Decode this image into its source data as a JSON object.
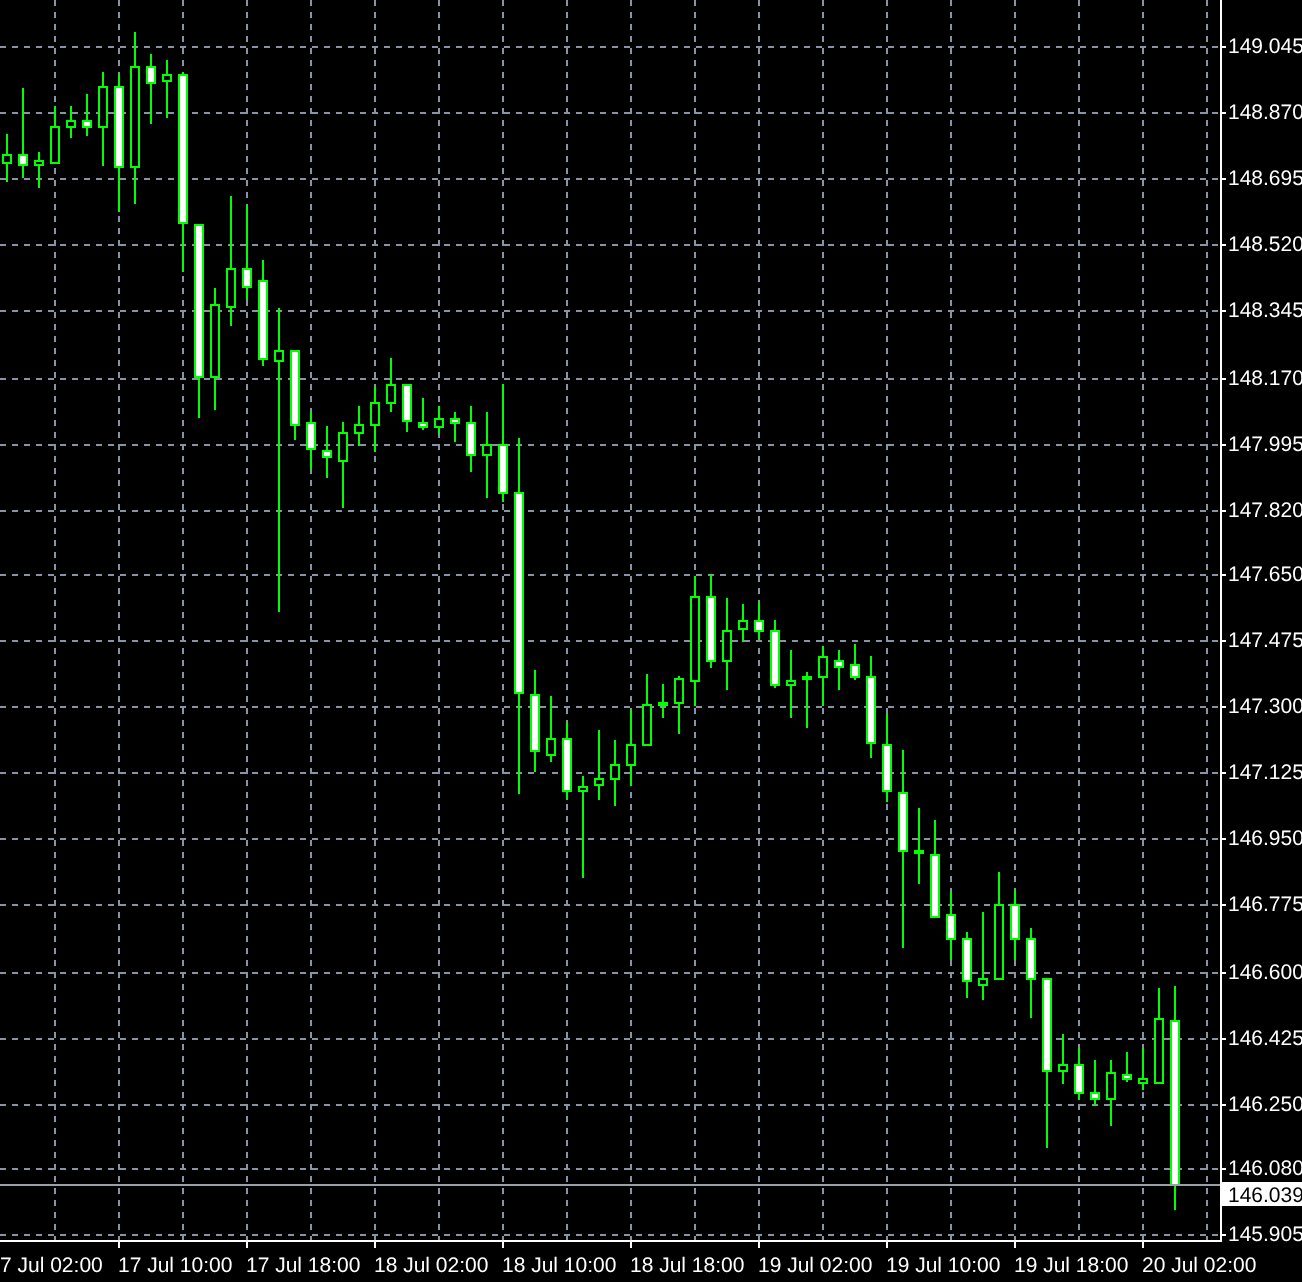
{
  "chart": {
    "time_axis": {
      "labels": [
        "7 Jul 02:00",
        "17 Jul 10:00",
        "17 Jul 18:00",
        "18 Jul 02:00",
        "18 Jul 10:00",
        "18 Jul 18:00",
        "19 Jul 02:00",
        "19 Jul 10:00",
        "19 Jul 18:00",
        "20 Jul 02:00"
      ]
    },
    "chart_data": {
      "type": "candlestick",
      "ylim": [
        145.905,
        149.045
      ],
      "grid": true,
      "ref_lines": [
        {
          "axis": "y",
          "value": 146.039,
          "label": "146.039"
        }
      ],
      "yticks": [
        {
          "value": 149.045,
          "label": "149.045"
        },
        {
          "value": 148.87,
          "label": "148.870"
        },
        {
          "value": 148.695,
          "label": "148.695"
        },
        {
          "value": 148.52,
          "label": "148.520"
        },
        {
          "value": 148.345,
          "label": "148.345"
        },
        {
          "value": 148.17,
          "label": "148.170"
        },
        {
          "value": 147.995,
          "label": "147.995"
        },
        {
          "value": 147.82,
          "label": "147.820"
        },
        {
          "value": 147.65,
          "label": "147.650"
        },
        {
          "value": 147.475,
          "label": "147.475"
        },
        {
          "value": 147.3,
          "label": "147.300"
        },
        {
          "value": 147.125,
          "label": "147.125"
        },
        {
          "value": 146.95,
          "label": "146.950"
        },
        {
          "value": 146.775,
          "label": "146.775"
        },
        {
          "value": 146.6,
          "label": "146.600"
        },
        {
          "value": 146.425,
          "label": "146.425"
        },
        {
          "value": 146.25,
          "label": "146.250"
        },
        {
          "value": 146.08,
          "label": "146.080"
        },
        {
          "value": 145.905,
          "label": "145.905"
        }
      ],
      "categories": [
        null,
        null,
        null,
        null,
        null,
        null,
        null,
        null,
        null,
        null,
        null,
        null,
        null,
        null,
        null,
        null,
        null,
        null,
        null,
        null,
        null,
        null,
        null,
        null,
        null,
        null,
        null,
        null,
        null,
        null,
        null,
        null,
        null,
        null,
        null,
        null,
        null,
        null,
        null,
        null,
        null,
        null,
        null,
        null,
        null,
        null,
        null,
        null,
        null,
        null,
        null,
        null,
        null,
        null,
        null,
        null,
        null,
        null,
        null,
        null,
        null,
        null,
        null,
        null,
        null,
        null,
        null,
        null,
        null,
        null,
        null,
        null,
        null,
        null
      ],
      "ohlc": [
        [
          148.737,
          148.812,
          148.684,
          148.759
        ],
        [
          148.759,
          148.934,
          148.695,
          148.732
        ],
        [
          148.732,
          148.764,
          148.669,
          148.743
        ],
        [
          148.737,
          148.886,
          148.732,
          148.833
        ],
        [
          148.833,
          148.886,
          148.801,
          148.849
        ],
        [
          148.849,
          148.918,
          148.806,
          148.833
        ],
        [
          148.833,
          148.976,
          148.727,
          148.939
        ],
        [
          148.939,
          148.971,
          148.605,
          148.727
        ],
        [
          148.727,
          149.082,
          148.626,
          148.992
        ],
        [
          148.992,
          149.024,
          148.838,
          148.95
        ],
        [
          148.955,
          149.008,
          148.854,
          148.971
        ],
        [
          148.971,
          148.976,
          148.446,
          148.578
        ],
        [
          148.573,
          148.573,
          148.064,
          148.175
        ],
        [
          148.175,
          148.403,
          148.085,
          148.361
        ],
        [
          148.356,
          148.647,
          148.303,
          148.456
        ],
        [
          148.456,
          148.621,
          148.372,
          148.409
        ],
        [
          148.425,
          148.478,
          148.197,
          148.218
        ],
        [
          148.213,
          148.35,
          147.55,
          148.239
        ],
        [
          148.239,
          148.244,
          148.006,
          148.048
        ],
        [
          148.053,
          148.08,
          147.926,
          147.984
        ],
        [
          147.979,
          148.043,
          147.905,
          147.963
        ],
        [
          147.953,
          148.053,
          147.825,
          148.027
        ],
        [
          148.027,
          148.096,
          147.99,
          148.048
        ],
        [
          148.048,
          148.144,
          147.974,
          148.106
        ],
        [
          148.106,
          148.218,
          148.075,
          148.149
        ],
        [
          148.149,
          148.154,
          148.027,
          148.059
        ],
        [
          148.053,
          148.112,
          148.032,
          148.043
        ],
        [
          148.043,
          148.091,
          148.022,
          148.064
        ],
        [
          148.064,
          148.08,
          148.0,
          148.053
        ],
        [
          148.053,
          148.096,
          147.921,
          147.969
        ],
        [
          147.969,
          148.08,
          147.852,
          147.995
        ],
        [
          147.995,
          148.149,
          147.841,
          147.868
        ],
        [
          147.868,
          148.011,
          147.067,
          147.337
        ],
        [
          147.332,
          147.396,
          147.125,
          147.184
        ],
        [
          147.173,
          147.327,
          147.152,
          147.215
        ],
        [
          147.215,
          147.258,
          147.051,
          147.078
        ],
        [
          147.078,
          147.115,
          146.844,
          147.088
        ],
        [
          147.093,
          147.237,
          147.051,
          147.109
        ],
        [
          147.109,
          147.21,
          147.035,
          147.147
        ],
        [
          147.147,
          147.29,
          147.088,
          147.2
        ],
        [
          147.2,
          147.385,
          147.194,
          147.306
        ],
        [
          147.306,
          147.359,
          147.268,
          147.311
        ],
        [
          147.311,
          147.38,
          147.226,
          147.375
        ],
        [
          147.369,
          147.645,
          147.3,
          147.592
        ],
        [
          147.592,
          147.65,
          147.401,
          147.422
        ],
        [
          147.422,
          147.587,
          147.343,
          147.502
        ],
        [
          147.507,
          147.571,
          147.47,
          147.528
        ],
        [
          147.528,
          147.576,
          147.475,
          147.502
        ],
        [
          147.502,
          147.528,
          147.348,
          147.359
        ],
        [
          147.359,
          147.449,
          147.268,
          147.369
        ],
        [
          147.375,
          147.39,
          147.242,
          147.38
        ],
        [
          147.38,
          147.459,
          147.3,
          147.433
        ],
        [
          147.422,
          147.449,
          147.343,
          147.406
        ],
        [
          147.412,
          147.465,
          147.369,
          147.38
        ],
        [
          147.38,
          147.433,
          147.162,
          147.205
        ],
        [
          147.2,
          147.279,
          147.046,
          147.078
        ],
        [
          147.072,
          147.184,
          146.659,
          146.918
        ],
        [
          146.913,
          147.03,
          146.828,
          146.918
        ],
        [
          146.908,
          146.998,
          146.738,
          146.743
        ],
        [
          146.749,
          146.807,
          146.627,
          146.69
        ],
        [
          146.69,
          146.701,
          146.531,
          146.574
        ],
        [
          146.568,
          146.754,
          146.521,
          146.579
        ],
        [
          146.584,
          146.86,
          146.579,
          146.775
        ],
        [
          146.775,
          146.812,
          146.627,
          146.685
        ],
        [
          146.685,
          146.712,
          146.478,
          146.579
        ],
        [
          146.579,
          146.579,
          146.134,
          146.341
        ],
        [
          146.341,
          146.431,
          146.303,
          146.356
        ],
        [
          146.356,
          146.394,
          146.261,
          146.282
        ],
        [
          146.282,
          146.367,
          146.245,
          146.266
        ],
        [
          146.266,
          146.367,
          146.192,
          146.335
        ],
        [
          146.33,
          146.388,
          146.309,
          146.319
        ],
        [
          146.309,
          146.394,
          146.288,
          146.319
        ],
        [
          146.309,
          146.553,
          146.309,
          146.478
        ],
        [
          146.473,
          146.563,
          145.969,
          146.039
        ]
      ]
    }
  }
}
